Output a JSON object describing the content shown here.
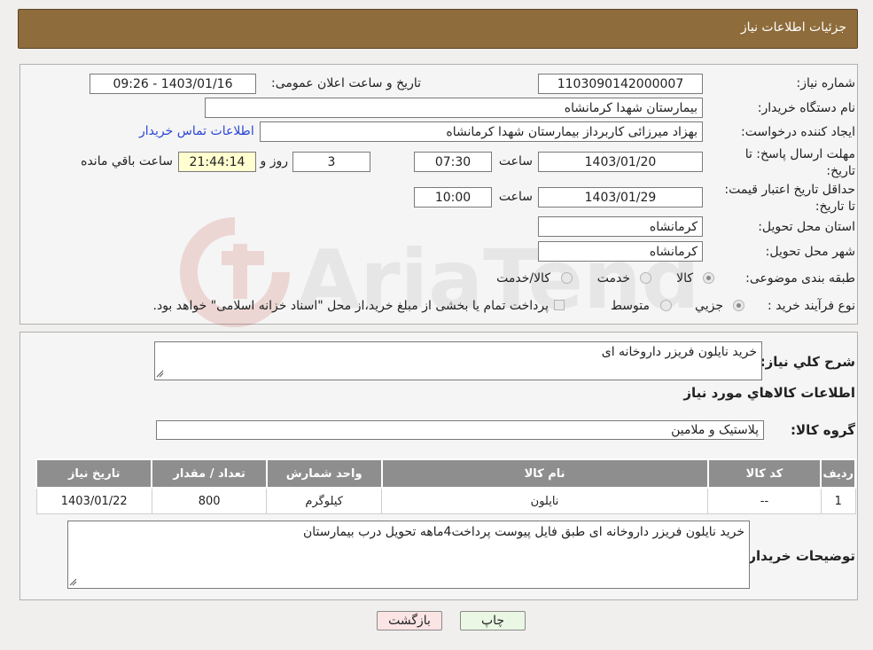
{
  "header": {
    "title": "جزئیات اطلاعات نیاز"
  },
  "form": {
    "need_number_label": "شماره نیاز:",
    "need_number": "1103090142000007",
    "announce_label": "تاریخ و ساعت اعلان عمومی:",
    "announce_value": "1403/01/16 - 09:26",
    "buyer_org_label": "نام دستگاه خریدار:",
    "buyer_org": "بیمارستان شهدا کرمانشاه",
    "creator_label": "ایجاد کننده درخواست:",
    "creator": "بهزاد میرزائی کاربرداز بیمارستان شهدا کرمانشاه",
    "contact_link": "اطلاعات تماس خریدار",
    "reply_deadline_label": "مهلت ارسال پاسخ: تا تاریخ:",
    "reply_date": "1403/01/20",
    "time_label": "ساعت",
    "reply_time": "07:30",
    "days_value": "3",
    "days_label": "روز و",
    "remaining_time": "21:44:14",
    "remaining_label": "ساعت باقي مانده",
    "validity_label": "حداقل تاریخ اعتبار قیمت: تا تاریخ:",
    "validity_date": "1403/01/29",
    "validity_time": "10:00",
    "province_label": "استان محل تحویل:",
    "province": "کرمانشاه",
    "city_label": "شهر محل تحویل:",
    "city": "کرمانشاه",
    "category_label": "طبقه بندی موضوعی:",
    "category_options": [
      "کالا",
      "خدمت",
      "کالا/خدمت"
    ],
    "process_label": "نوع فرآیند خرید :",
    "process_options": [
      "جزیي",
      "متوسط"
    ],
    "payment_note": "پرداخت تمام یا بخشی از مبلغ خرید،از محل \"اسناد خزانه اسلامی\" خواهد بود."
  },
  "details": {
    "summary_label": "شرح کلي نياز:",
    "summary": "خرید نایلون فریزر داروخانه ای",
    "goods_info_title": "اطلاعات کالاهاي مورد نياز",
    "group_label": "گروه کالا:",
    "group": "پلاستیک و ملامین",
    "table": {
      "headers": [
        "رديف",
        "کد کالا",
        "نام کالا",
        "واحد شمارش",
        "تعداد / مقدار",
        "تاریخ نیاز"
      ],
      "rows": [
        [
          "1",
          "--",
          "نایلون",
          "کیلوگرم",
          "800",
          "1403/01/22"
        ]
      ]
    },
    "buyer_notes_label": "توضیحات خریدار:",
    "buyer_notes": "خرید نایلون فریزر داروخانه ای طبق فایل پیوست  پرداخت4ماهه تحویل درب بیمارستان"
  },
  "buttons": {
    "print": "چاپ",
    "back": "بازگشت"
  },
  "colors": {
    "header": "#8e6c3b",
    "table_header": "#8e8e8e",
    "back_button": "#fbe4e4",
    "print_button": "#eaf7e4"
  }
}
